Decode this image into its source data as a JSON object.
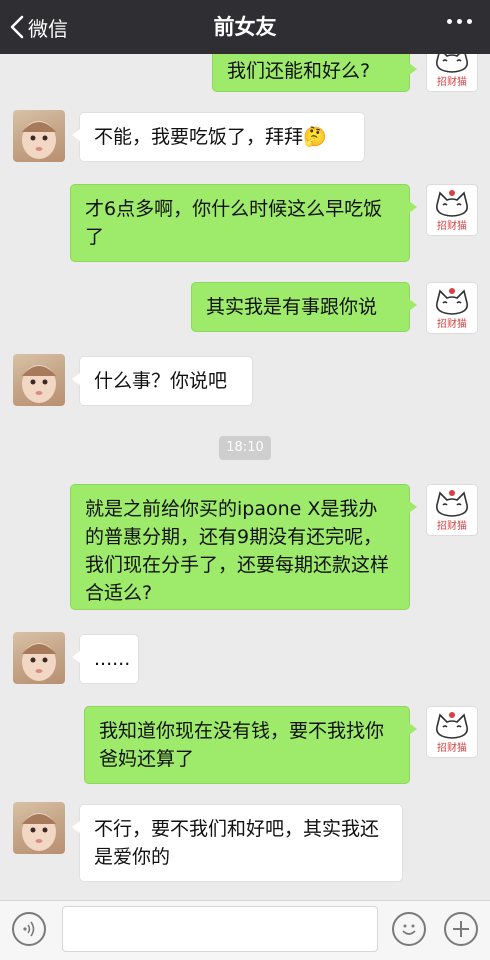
{
  "header": {
    "back_label": "微信",
    "title": "前女友"
  },
  "icons": {
    "back": "chevron-left-icon",
    "more": "more-dots-icon",
    "voice": "voice-icon",
    "emoji": "emoji-icon",
    "plus": "plus-icon"
  },
  "colors": {
    "outgoing_bubble": "#9eea6a",
    "incoming_bubble": "#ffffff",
    "header_bg": "#2f2f33",
    "chat_bg": "#ebebeb"
  },
  "avatars": {
    "cat_label": "招财猫"
  },
  "messages": [
    {
      "side": "out",
      "text": "我们还能和好么?"
    },
    {
      "side": "in",
      "text": "不能，我要吃饭了，拜拜🤔"
    },
    {
      "side": "out",
      "text": "才6点多啊，你什么时候这么早吃饭了"
    },
    {
      "side": "out",
      "text": "其实我是有事跟你说"
    },
    {
      "side": "in",
      "text": "什么事？你说吧"
    },
    {
      "side": "out",
      "text": "就是之前给你买的ipaone X是我办的普惠分期，还有9期没有还完呢，我们现在分手了，还要每期还款这样合适么?"
    },
    {
      "side": "in",
      "text": "......"
    },
    {
      "side": "out",
      "text": "我知道你现在没有钱，要不我找你爸妈还算了"
    },
    {
      "side": "in",
      "text": "不行，要不我们和好吧，其实我还是爱你的"
    }
  ],
  "timestamp": "18:10",
  "input": {
    "value": "",
    "placeholder": ""
  }
}
